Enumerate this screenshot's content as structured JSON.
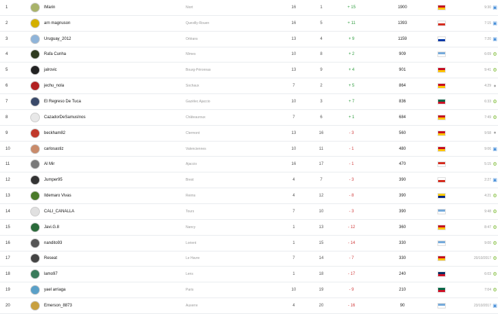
{
  "rows": [
    {
      "rank": "1",
      "name": "lMarin",
      "club": "Niort",
      "played": "16",
      "position": "1",
      "diff": "+ 15",
      "diff_type": "up",
      "points": "1900",
      "flag_colors": [
        "#c60b1e",
        "#ffc400"
      ],
      "time": "9:30",
      "device": "pc-icon",
      "avatar_color": "#a8b36a"
    },
    {
      "rank": "2",
      "name": "arn magnuson",
      "club": "Quevilly-Rouen",
      "played": "16",
      "position": "5",
      "diff": "+ 11",
      "diff_type": "up",
      "points": "1393",
      "flag_colors": [
        "#ffffff",
        "#d52b1e"
      ],
      "time": "7:15",
      "device": "pc-icon",
      "avatar_color": "#d4b000"
    },
    {
      "rank": "3",
      "name": "Uruguay_2012",
      "club": "Orléans",
      "played": "13",
      "position": "4",
      "diff": "+ 9",
      "diff_type": "up",
      "points": "1159",
      "flag_colors": [
        "#ffffff",
        "#0038a8"
      ],
      "time": "7:20",
      "device": "pc-icon",
      "avatar_color": "#8fb4d9"
    },
    {
      "rank": "4",
      "name": "Rafa Cunha",
      "club": "Nîmes",
      "played": "10",
      "position": "8",
      "diff": "+ 2",
      "diff_type": "up",
      "points": "909",
      "flag_colors": [
        "#75aadb",
        "#ffffff"
      ],
      "time": "6:09",
      "device": "android-icon",
      "avatar_color": "#2f3b1f"
    },
    {
      "rank": "5",
      "name": "jalrovic",
      "club": "Bourg-Péronnas",
      "played": "13",
      "position": "9",
      "diff": "+ 4",
      "diff_type": "up",
      "points": "901",
      "flag_colors": [
        "#c60b1e",
        "#ffc400"
      ],
      "time": "9:41",
      "device": "android-icon",
      "avatar_color": "#222222"
    },
    {
      "rank": "6",
      "name": "jechu_nola",
      "club": "Sochaux",
      "played": "7",
      "position": "2",
      "diff": "+ 5",
      "diff_type": "up",
      "points": "864",
      "flag_colors": [
        "#c60b1e",
        "#ffc400"
      ],
      "time": "4:29",
      "device": "ios-icon",
      "avatar_color": "#b22222"
    },
    {
      "rank": "7",
      "name": "El Regreso De Tuca",
      "club": "Gazélec Ajaccio",
      "played": "10",
      "position": "3",
      "diff": "+ 7",
      "diff_type": "up",
      "points": "836",
      "flag_colors": [
        "#006847",
        "#ce1126"
      ],
      "time": "6:33",
      "device": "android-icon",
      "avatar_color": "#3a4a6a"
    },
    {
      "rank": "8",
      "name": "CazadorDeSamusInos",
      "club": "Châteauroux",
      "played": "7",
      "position": "6",
      "diff": "+ 1",
      "diff_type": "up",
      "points": "684",
      "flag_colors": [
        "#c60b1e",
        "#ffc400"
      ],
      "time": "7:49",
      "device": "android-icon",
      "avatar_color": "#e8e8e8"
    },
    {
      "rank": "9",
      "name": "beckham82",
      "club": "Clermont",
      "played": "13",
      "position": "16",
      "diff": "- 3",
      "diff_type": "down",
      "points": "560",
      "flag_colors": [
        "#c60b1e",
        "#ffc400"
      ],
      "time": "9:58",
      "device": "ios-icon",
      "avatar_color": "#c0392b"
    },
    {
      "rank": "10",
      "name": "carlosastiz",
      "club": "Valenciennes",
      "played": "10",
      "position": "11",
      "diff": "- 1",
      "diff_type": "down",
      "points": "480",
      "flag_colors": [
        "#c60b1e",
        "#ffc400"
      ],
      "time": "9:06",
      "device": "pc-icon",
      "avatar_color": "#c98b6b"
    },
    {
      "rank": "11",
      "name": "Al Mir",
      "club": "Ajaccio",
      "played": "16",
      "position": "17",
      "diff": "- 1",
      "diff_type": "down",
      "points": "470",
      "flag_colors": [
        "#d52b1e",
        "#ffffff"
      ],
      "time": "5:15",
      "device": "android-icon",
      "avatar_color": "#7a7a7a"
    },
    {
      "rank": "12",
      "name": "Jumper95",
      "club": "Brest",
      "played": "4",
      "position": "7",
      "diff": "- 3",
      "diff_type": "down",
      "points": "390",
      "flag_colors": [
        "#ffffff",
        "#d52b1e"
      ],
      "time": "2:27",
      "device": "pc-icon",
      "avatar_color": "#333333"
    },
    {
      "rank": "13",
      "name": "Ildemaro Vivas",
      "club": "Reims",
      "played": "4",
      "position": "12",
      "diff": "- 8",
      "diff_type": "down",
      "points": "390",
      "flag_colors": [
        "#ffcc00",
        "#00247d"
      ],
      "time": "4:21",
      "device": "android-icon",
      "avatar_color": "#4a7a2a"
    },
    {
      "rank": "14",
      "name": "CALI_CANALLA",
      "club": "Tours",
      "played": "7",
      "position": "10",
      "diff": "- 3",
      "diff_type": "down",
      "points": "390",
      "flag_colors": [
        "#75aadb",
        "#ffffff"
      ],
      "time": "9:48",
      "device": "android-icon",
      "avatar_color": "#e0e0e0"
    },
    {
      "rank": "15",
      "name": "Javi.G.8",
      "club": "Nancy",
      "played": "1",
      "position": "13",
      "diff": "- 12",
      "diff_type": "down",
      "points": "360",
      "flag_colors": [
        "#c60b1e",
        "#ffc400"
      ],
      "time": "8:47",
      "device": "android-icon",
      "avatar_color": "#2a6a3a"
    },
    {
      "rank": "16",
      "name": "nandito93",
      "club": "Lorient",
      "played": "1",
      "position": "15",
      "diff": "- 14",
      "diff_type": "down",
      "points": "330",
      "flag_colors": [
        "#75aadb",
        "#ffffff"
      ],
      "time": "9:00",
      "device": "android-icon",
      "avatar_color": "#555555"
    },
    {
      "rank": "17",
      "name": "Reseat",
      "club": "Le Havre",
      "played": "7",
      "position": "14",
      "diff": "- 7",
      "diff_type": "down",
      "points": "330",
      "flag_colors": [
        "#c60b1e",
        "#ffc400"
      ],
      "time": "20/10/2017",
      "device": "android-icon",
      "avatar_color": "#444444"
    },
    {
      "rank": "18",
      "name": "lamo97",
      "club": "Lens",
      "played": "1",
      "position": "18",
      "diff": "- 17",
      "diff_type": "down",
      "points": "240",
      "flag_colors": [
        "#002d62",
        "#ce1126"
      ],
      "time": "6:03",
      "device": "android-icon",
      "avatar_color": "#3a7a5a"
    },
    {
      "rank": "19",
      "name": "yael arriaga",
      "club": "Paris",
      "played": "10",
      "position": "19",
      "diff": "- 9",
      "diff_type": "down",
      "points": "210",
      "flag_colors": [
        "#006847",
        "#ce1126"
      ],
      "time": "7:04",
      "device": "android-icon",
      "avatar_color": "#5aa0c8"
    },
    {
      "rank": "20",
      "name": "Emerson_8873",
      "club": "Auxerre",
      "played": "4",
      "position": "20",
      "diff": "- 16",
      "diff_type": "down",
      "points": "90",
      "flag_colors": [
        "#75aadb",
        "#ffffff"
      ],
      "time": "23/10/2017",
      "device": "pc-icon",
      "avatar_color": "#c8a040"
    }
  ]
}
